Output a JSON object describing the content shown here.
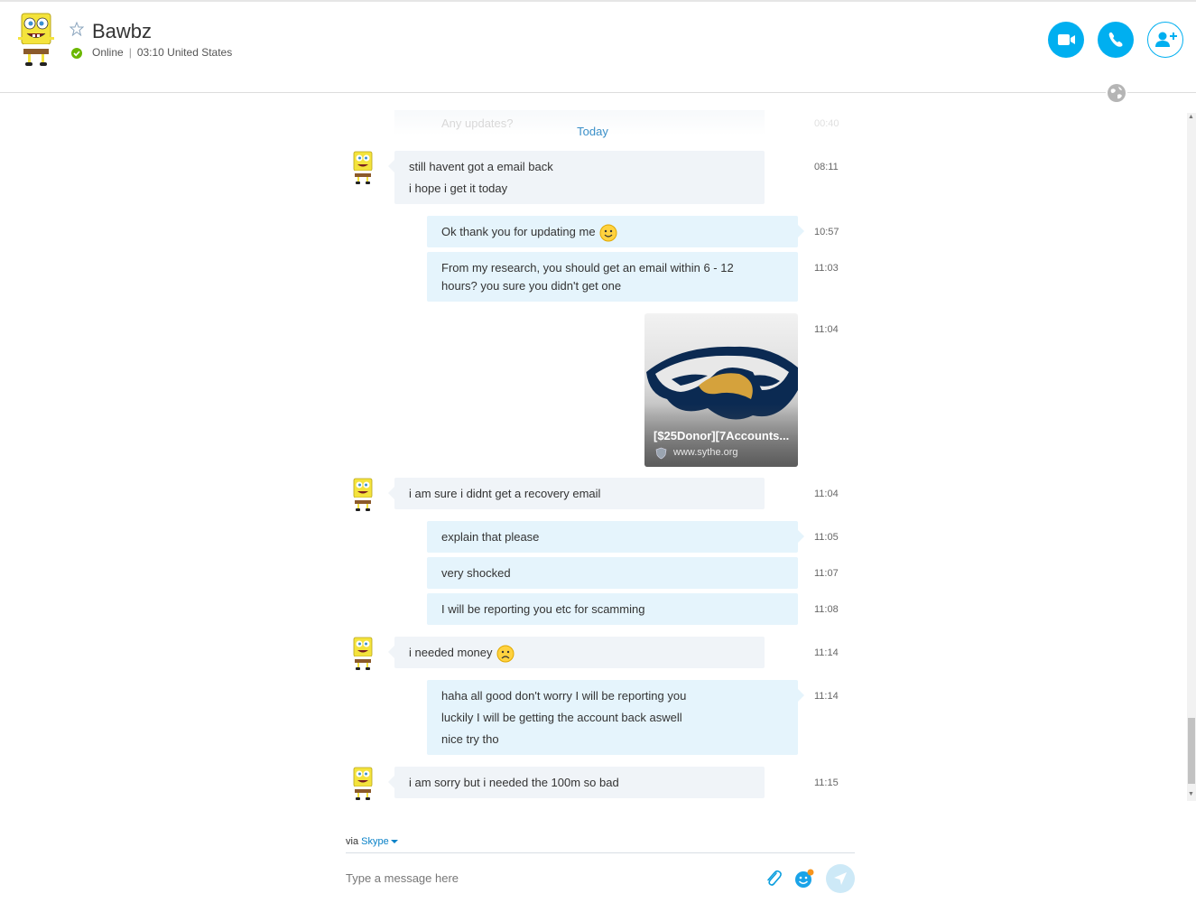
{
  "header": {
    "contact_name": "Bawbz",
    "status": "Online",
    "local_time": "03:10 United States"
  },
  "conversation": {
    "faded_message": "Any updates?",
    "faded_time": "00:40",
    "day_divider": "Today",
    "messages": [
      {
        "direction": "incoming",
        "lines": [
          "still havent got a email back",
          "i hope i get it today"
        ],
        "time": "08:11"
      },
      {
        "direction": "outgoing",
        "lines": [
          "Ok thank you for updating me"
        ],
        "emoji": "smile-emoticon",
        "time": "10:57"
      },
      {
        "direction": "outgoing",
        "lines": [
          "From my research, you should get an email within 6 - 12",
          "hours?  you sure you didn't get one"
        ],
        "time": "11:03"
      },
      {
        "direction": "outgoing",
        "link_card": {
          "title": "[$25Donor][7Accounts...",
          "url": "www.sythe.org"
        },
        "time": "11:04"
      },
      {
        "direction": "incoming",
        "lines": [
          "i am sure i didnt get a recovery email"
        ],
        "time": "11:04"
      },
      {
        "direction": "outgoing",
        "lines": [
          "explain that please"
        ],
        "time": "11:05"
      },
      {
        "direction": "outgoing",
        "lines": [
          "very shocked"
        ],
        "time": "11:07"
      },
      {
        "direction": "outgoing",
        "lines": [
          "I will be reporting you etc for scamming"
        ],
        "time": "11:08"
      },
      {
        "direction": "incoming",
        "lines": [
          "i needed money"
        ],
        "emoji": "sad-emoticon",
        "time": "11:14"
      },
      {
        "direction": "outgoing",
        "lines": [
          "haha all good  don't worry I will be reporting you",
          "luckily I will be getting the account back aswell",
          "nice try tho"
        ],
        "time": "11:14"
      },
      {
        "direction": "incoming",
        "lines": [
          "i am sorry but i needed the 100m so bad"
        ],
        "time": "11:15"
      }
    ]
  },
  "compose": {
    "via_prefix": "via",
    "via_service": "Skype",
    "placeholder": "Type a message here"
  },
  "colors": {
    "accent": "#00aff0",
    "online": "#6bb700",
    "incoming_bubble": "#f0f4f8",
    "outgoing_bubble": "#e5f4fc"
  },
  "icons": [
    "star-icon",
    "video-call-icon",
    "phone-icon",
    "add-contact-icon",
    "globe-icon",
    "attach-icon",
    "emoji-icon",
    "send-icon"
  ]
}
